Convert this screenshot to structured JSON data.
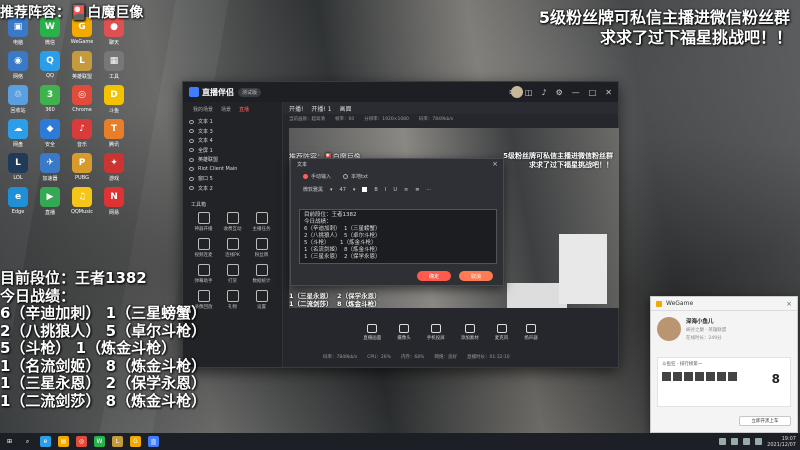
{
  "overlay": {
    "top_left_banner": "推荐阵容：🎴白魔巨像",
    "top_right_line1": "5级粉丝牌可私信主播进微信粉丝群",
    "top_right_line2": "求求了过下福星挑战吧！！"
  },
  "stats": {
    "rank": "目前段位：王者1382",
    "title": "今日战绩：",
    "rows": [
      "6（辛迪加刺）  1（三星螃蟹）",
      "2（八挑狼人）  5（卓尔斗枪）",
      "5（斗枪）      1（炼金斗枪）",
      "1（名流剑姬）  8（炼金斗枪）",
      "1（三星永恩）  2（保学永恩）",
      "1（二流剑莎）  8（炼金斗枪）"
    ]
  },
  "desktop_icons": [
    {
      "label": "电脑",
      "color": "#3a78c8",
      "glyph": "▣"
    },
    {
      "label": "微信",
      "color": "#29b24a",
      "glyph": "W"
    },
    {
      "label": "WeGame",
      "color": "#f2a900",
      "glyph": "G"
    },
    {
      "label": "聊天",
      "color": "#e05050",
      "glyph": "●"
    },
    {
      "label": "网络",
      "color": "#3a78c8",
      "glyph": "◉"
    },
    {
      "label": "QQ",
      "color": "#2a9ee8",
      "glyph": "Q"
    },
    {
      "label": "英雄联盟",
      "color": "#c49a3c",
      "glyph": "L"
    },
    {
      "label": "工具",
      "color": "#777",
      "glyph": "▦"
    },
    {
      "label": "回收站",
      "color": "#5aa0e0",
      "glyph": "♲"
    },
    {
      "label": "360",
      "color": "#3fb24d",
      "glyph": "3"
    },
    {
      "label": "Chrome",
      "color": "#e14b3b",
      "glyph": "◎"
    },
    {
      "label": "斗鱼",
      "color": "#f3c300",
      "glyph": "D"
    },
    {
      "label": "网盘",
      "color": "#2a9ee8",
      "glyph": "☁"
    },
    {
      "label": "安全",
      "color": "#2d7bd6",
      "glyph": "◆"
    },
    {
      "label": "音乐",
      "color": "#d93b3b",
      "glyph": "♪"
    },
    {
      "label": "腾讯",
      "color": "#e87d2a",
      "glyph": "T"
    },
    {
      "label": "LOL",
      "color": "#203a5a",
      "glyph": "L"
    },
    {
      "label": "加速器",
      "color": "#3a78c8",
      "glyph": "✈"
    },
    {
      "label": "PUBG",
      "color": "#d79a2c",
      "glyph": "P"
    },
    {
      "label": "游戏",
      "color": "#c33",
      "glyph": "✦"
    },
    {
      "label": "Edge",
      "color": "#1f8fd8",
      "glyph": "e"
    },
    {
      "label": "直播",
      "color": "#35a853",
      "glyph": "▶"
    },
    {
      "label": "QQMusic",
      "color": "#f5c518",
      "glyph": "♫"
    },
    {
      "label": "网易",
      "color": "#d33",
      "glyph": "N"
    }
  ],
  "app": {
    "title": "直播伴侣",
    "version": "测试版",
    "left_tabs": [
      "我的场景",
      "场景",
      "直播"
    ],
    "sources": [
      "文本 1",
      "文本 3",
      "文本 4",
      "全屏 1",
      "英雄联盟",
      "Riot Client Main",
      "窗口 5",
      "文本 2"
    ],
    "tools_title": "工具箱",
    "tools": [
      "神器开播",
      "收费互动",
      "主播任务",
      "视频连麦",
      "连线PK",
      "粉丝牌",
      "弹幕助手",
      "打赏",
      "数据统计",
      "录像回放",
      "礼物",
      "设置"
    ],
    "tabs": [
      "开播!",
      "开播! 1",
      "画面"
    ],
    "info": [
      "当前画质：超高清",
      "帧率：60",
      "分辨率：1920×1080",
      "码率：7849kb/s"
    ],
    "preview_top": "5级粉丝牌可私信主播进微信粉丝群\n求求了过下福星挑战吧！！",
    "preview_left": "推荐阵容：🎴白魔巨像",
    "preview_bottom": "1（三星永恩）  2（保学永恩）\n1（二流剑莎）  8（炼金斗枪）",
    "bottom_buttons": [
      "直播画面",
      "摄像头",
      "手机投屏",
      "添加素材",
      "麦克风",
      "扬声器"
    ],
    "status": [
      "码率：7849kb/s",
      "CPU：26%",
      "内存：68%",
      "网络：良好",
      "直播时长：01:32:10"
    ]
  },
  "dialog": {
    "title": "文本",
    "radio1": "手动输入",
    "radio2": "本地txt",
    "font": "微软雅黑",
    "size": "47",
    "textarea": "目前段位：王者1382\n今日战绩：\n6（辛迪加刺）  1（三星螃蟹）\n2（八挑狼人）  5（卓尔斗枪）\n5（斗枪）      1（炼金斗枪）\n1（名流剑姬）  8（炼金斗枪）\n1（三星永恩）  2（保学永恩）",
    "ok": "确定",
    "cancel": "取消"
  },
  "wegame": {
    "app": "WeGame",
    "name": "深海小鱼儿",
    "sub1": "峡谷之巅 · 英雄联盟",
    "sub2": "在线时长：249分",
    "rank": "斗鱼狂 · 排行榜第一",
    "big_value": "8",
    "button": "立即开黑上车"
  },
  "taskbar": {
    "time": "19:07",
    "date": "2021/12/07"
  }
}
